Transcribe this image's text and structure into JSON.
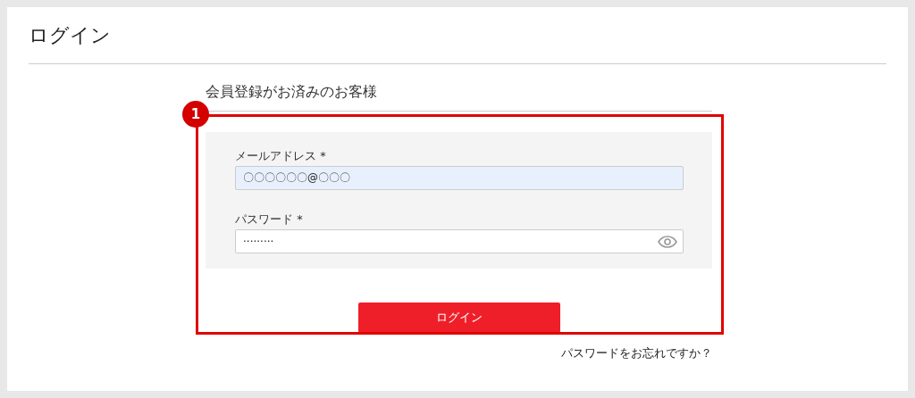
{
  "page": {
    "title": "ログイン"
  },
  "login_section": {
    "heading": "会員登録がお済みのお客様",
    "fields": [
      {
        "kind": "email",
        "label": "メールアドレス *",
        "value": "〇〇〇〇〇〇@〇〇〇",
        "autofilled": true
      },
      {
        "kind": "password",
        "label": "パスワード *",
        "value": "·········",
        "autofilled": false
      }
    ],
    "submit_button": "ログイン",
    "forgot_link": "パスワードをお忘れですか？"
  },
  "annotation": {
    "number": "1"
  }
}
